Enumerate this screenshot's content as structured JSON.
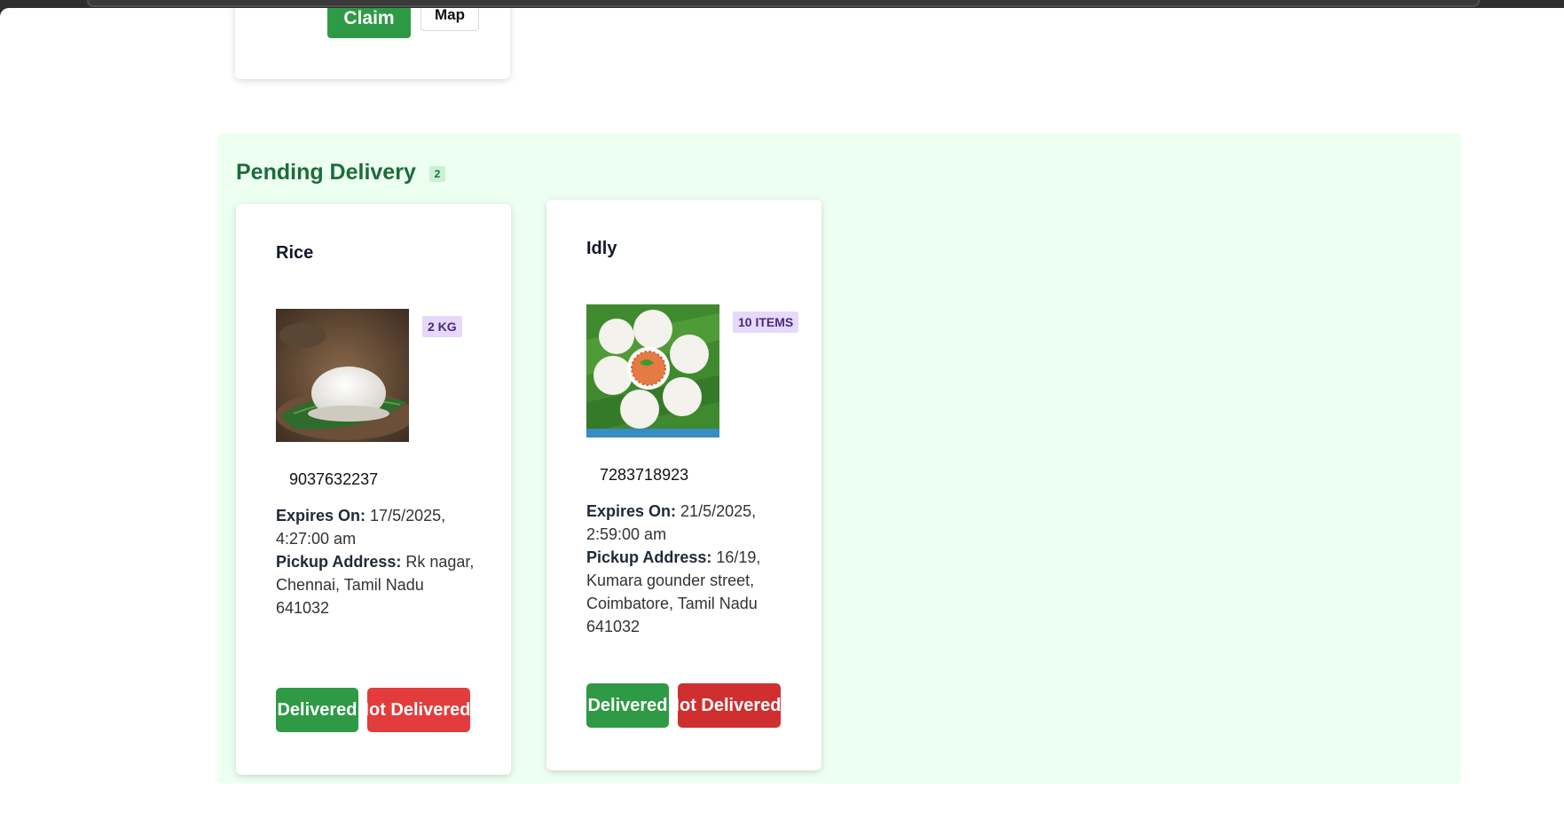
{
  "top_card": {
    "claim_label": "Claim",
    "map_label": "Map"
  },
  "section": {
    "title": "Pending Delivery",
    "count": "2",
    "background": "#edfff1"
  },
  "donations": [
    {
      "name": "Rice",
      "quantity": "2 KG",
      "image_icon": "rice-photo",
      "phone": "9037632237",
      "expires_label": "Expires On:",
      "expires_value": "17/5/2025, 4:27:00 am",
      "address_label": "Pickup Address:",
      "address_value": "Rk nagar, Chennai, Tamil Nadu 641032",
      "delivered_label": "Delivered",
      "not_delivered_label": "Not Delivered"
    },
    {
      "name": "Idly",
      "quantity": "10 ITEMS",
      "image_icon": "idly-photo",
      "phone": "7283718923",
      "expires_label": "Expires On:",
      "expires_value": "21/5/2025, 2:59:00 am",
      "address_label": "Pickup Address:",
      "address_value": "16/19, Kumara gounder street, Coimbatore, Tamil Nadu 641032",
      "delivered_label": "Delivered",
      "not_delivered_label": "Not Delivered"
    }
  ],
  "colors": {
    "green_button": "#2e9a45",
    "red_button": "#e23c3c",
    "badge_purple": "#e6d9fb",
    "title_green": "#1e6b3b"
  }
}
